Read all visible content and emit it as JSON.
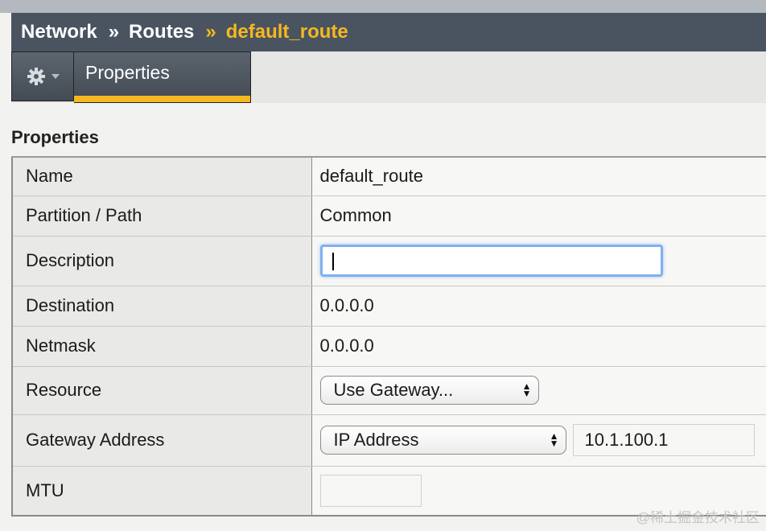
{
  "breadcrumb": {
    "items": [
      "Network",
      "Routes",
      "default_route"
    ],
    "separator": "»",
    "active_color": "#f5b820"
  },
  "tabs": {
    "gear_menu_icon": "gear-icon",
    "items": [
      {
        "label": "Properties",
        "active": true
      }
    ]
  },
  "section": {
    "title": "Properties"
  },
  "properties": {
    "name": {
      "label": "Name",
      "value": "default_route"
    },
    "partition": {
      "label": "Partition / Path",
      "value": "Common"
    },
    "description": {
      "label": "Description",
      "value": ""
    },
    "destination": {
      "label": "Destination",
      "value": "0.0.0.0"
    },
    "netmask": {
      "label": "Netmask",
      "value": "0.0.0.0"
    },
    "resource": {
      "label": "Resource",
      "selected": "Use Gateway..."
    },
    "gateway": {
      "label": "Gateway Address",
      "type_selected": "IP Address",
      "address": "10.1.100.1"
    },
    "mtu": {
      "label": "MTU",
      "value": ""
    }
  },
  "watermark": "@稀土掘金技术社区",
  "colors": {
    "header_bg": "#4a5460",
    "accent": "#f5b820",
    "focus_ring": "#7fb1ee"
  }
}
